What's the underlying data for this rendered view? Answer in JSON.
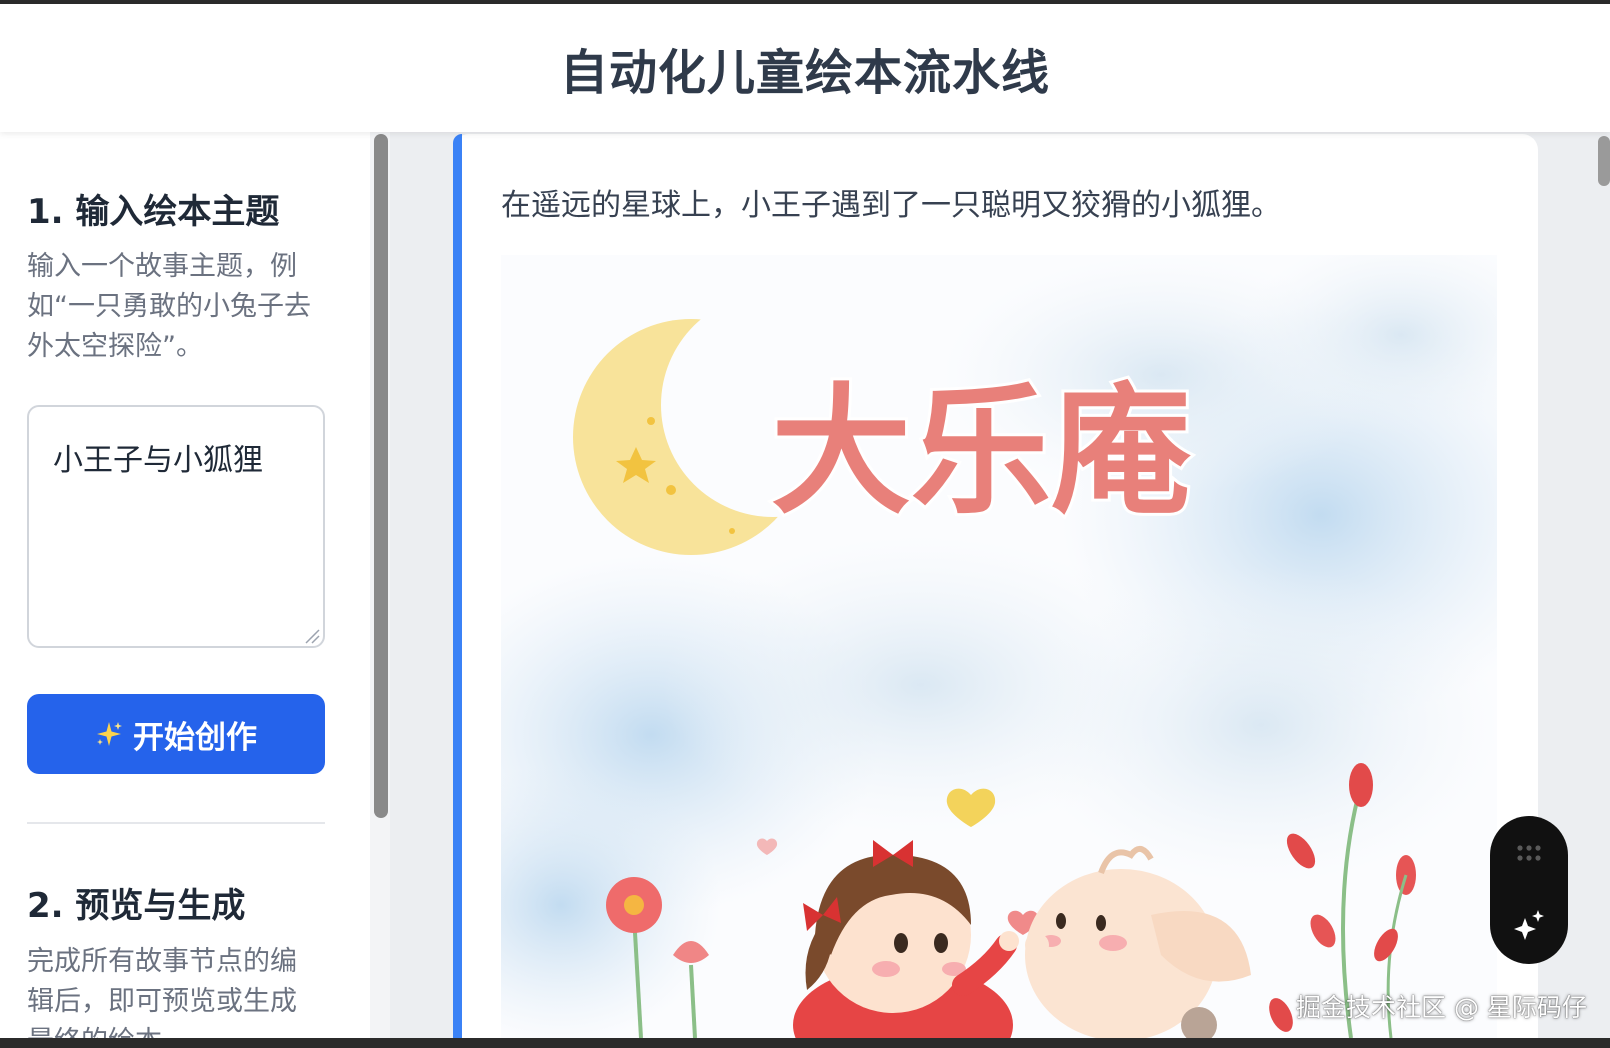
{
  "header": {
    "title": "自动化儿童绘本流水线"
  },
  "sidebar": {
    "step1": {
      "title": "1. 输入绘本主题",
      "desc_lines": [
        "输入一个故事主题，例",
        "如“一只勇敢的小兔子去",
        "外太空探险”。"
      ]
    },
    "theme_input": {
      "value": "小王子与小狐狸"
    },
    "start_button": {
      "icon": "sparkle-icon",
      "label": "开始创作"
    },
    "step2": {
      "title": "2. 预览与生成",
      "desc_lines": [
        "完成所有故事节点的编",
        "辑后，即可预览或生成",
        "最终的绘本"
      ]
    }
  },
  "main": {
    "story_text": "在遥远的星球上，小王子遇到了一只聪明又狡猾的小狐狸。",
    "illustration": {
      "title_text": "大乐庵"
    }
  },
  "floating_tool": {
    "icons": [
      "drag-handle-icon",
      "ai-sparkle-icon"
    ]
  },
  "watermark": {
    "text": "掘金技术社区 @ 星际码仔"
  },
  "colors": {
    "accent": "#2563eb",
    "card_border": "#3b82f6",
    "header_text": "#2f3a4a"
  }
}
